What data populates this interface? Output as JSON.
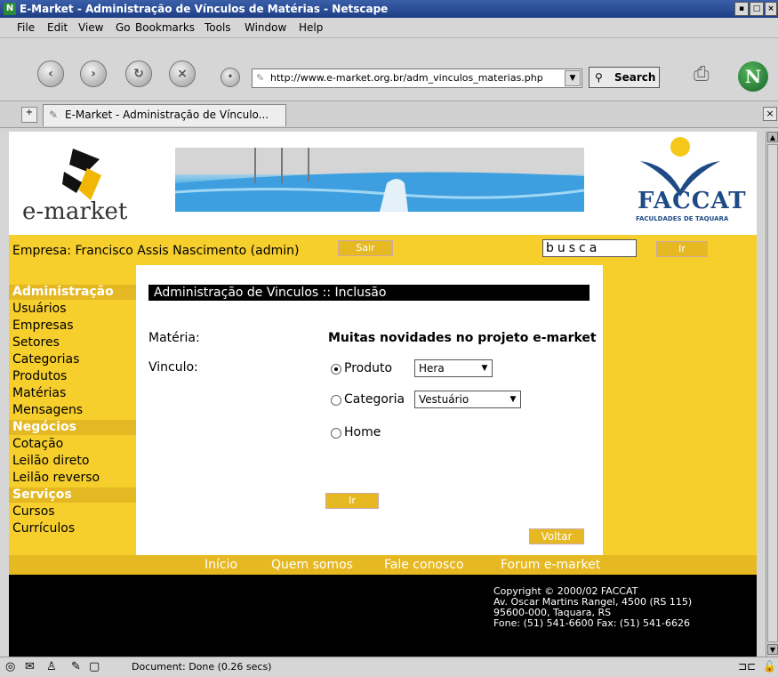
{
  "window": {
    "title": "E-Market - Administração de Vínculos de Matérias - Netscape",
    "btn_min": "▪",
    "btn_max": "□",
    "btn_close": "×"
  },
  "menu": [
    "File",
    "Edit",
    "View",
    "Go",
    "Bookmarks",
    "Tools",
    "Window",
    "Help"
  ],
  "toolbar": {
    "url": "http://www.e-market.org.br/adm_vinculos_materias.php",
    "search_label": "Search"
  },
  "tab": {
    "title": "E-Market - Administração de Vínculo..."
  },
  "header": {
    "logo_text": "e-market",
    "faccat_title": "FACCAT",
    "faccat_sub": "FACULDADES DE TAQUARA"
  },
  "topbar": {
    "empresa": "Empresa: Francisco Assis Nascimento (admin)",
    "sair": "Sair",
    "search_value": "busca",
    "go": "Ir"
  },
  "sidebar": {
    "admin_head": "Administração",
    "admin_items": [
      "Usuários",
      "Empresas",
      "Setores",
      "Categorias",
      "Produtos",
      "Matérias",
      "Mensagens"
    ],
    "neg_head": "Negócios",
    "neg_items": [
      "Cotação",
      "Leilão direto",
      "Leilão reverso"
    ],
    "serv_head": "Serviços",
    "serv_items": [
      "Cursos",
      "Currículos"
    ]
  },
  "form": {
    "title": "Administração de Vinculos :: Inclusão",
    "materia_label": "Matéria:",
    "materia_value": "Muitas novidades no projeto e-market",
    "vinculo_label": "Vinculo:",
    "opt_produto": "Produto",
    "produto_select": "Hera",
    "opt_categoria": "Categoria",
    "categoria_select": "Vestuário",
    "opt_home": "Home",
    "submit": "Ir",
    "back": "Voltar"
  },
  "footer": {
    "links": [
      "Início",
      "Quem somos",
      "Fale conosco",
      "Forum e-market"
    ],
    "copyright": [
      "Copyright © 2000/02 FACCAT",
      "Av. Oscar Martins Rangel, 4500 (RS 115)",
      "95600-000, Taquara, RS",
      "Fone: (51) 541-6600 Fax: (51) 541-6626"
    ]
  },
  "status": {
    "text": "Document: Done (0.26 secs)"
  },
  "colors": {
    "yellow": "#f6cf2d",
    "gold": "#e6b821",
    "black": "#000000"
  }
}
